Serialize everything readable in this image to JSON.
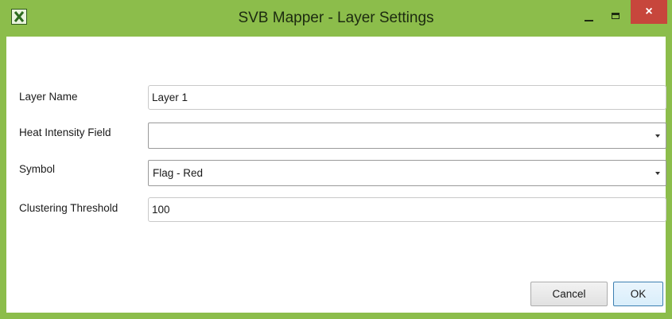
{
  "window": {
    "title": "SVB Mapper - Layer Settings",
    "accent_color": "#8cbd4b",
    "icon": "excel-app-icon",
    "controls": {
      "minimize": "minimize-icon",
      "maximize": "maximize-icon",
      "close": "×"
    },
    "close_color": "#c7463c"
  },
  "form": {
    "layer_name": {
      "label": "Layer Name",
      "value": "Layer 1"
    },
    "heat_intensity_field": {
      "label": "Heat Intensity Field",
      "value": ""
    },
    "symbol": {
      "label": "Symbol",
      "value": "Flag - Red"
    },
    "clustering_threshold": {
      "label": "Clustering Threshold",
      "value": "100"
    }
  },
  "buttons": {
    "cancel": "Cancel",
    "ok": "OK"
  }
}
